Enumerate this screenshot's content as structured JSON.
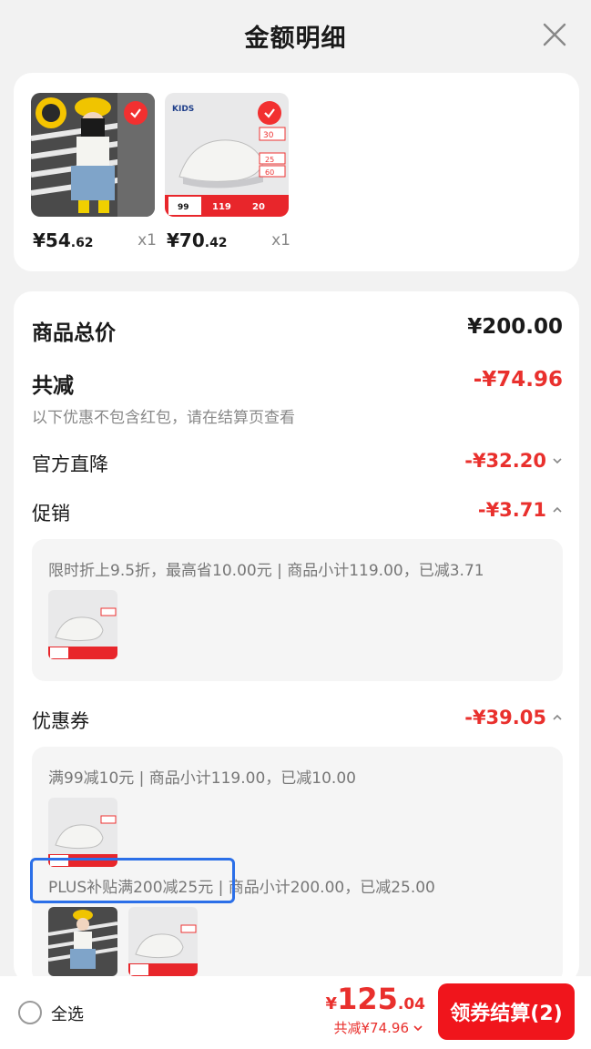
{
  "header": {
    "title": "金额明细"
  },
  "products": [
    {
      "price_int": "¥54",
      "price_dec": ".62",
      "qty": "x1"
    },
    {
      "price_int": "¥70",
      "price_dec": ".42",
      "qty": "x1"
    }
  ],
  "thumb_texts": {
    "kids": "KIDS",
    "p99": "99",
    "p119": "119",
    "p20": "20",
    "p30": "30",
    "p25": "25",
    "p60": "60"
  },
  "summary": {
    "total_label": "商品总价",
    "total_value": "¥200.00",
    "reduce_label": "共减",
    "reduce_value": "-¥74.96",
    "note": "以下优惠不包含红包，请在结算页查看"
  },
  "discounts": {
    "official": {
      "label": "官方直降",
      "value": "-¥32.20"
    },
    "promo": {
      "label": "促销",
      "value": "-¥3.71",
      "detail": "限时折上9.5折，最高省10.00元 | 商品小计119.00，已减3.71"
    },
    "coupon": {
      "label": "优惠券",
      "value": "-¥39.05",
      "detail1": "满99减10元 | 商品小计119.00，已减10.00",
      "detail2": "PLUS补贴满200减25元 | 商品小计200.00，已减25.00"
    }
  },
  "bottom": {
    "select_all": "全选",
    "total_cur": "¥",
    "total_int": "125",
    "total_dec": ".04",
    "saved": "共减¥74.96",
    "checkout": "领券结算(2)"
  },
  "colors": {
    "accent": "#e9302d",
    "button": "#f0151c",
    "highlight": "#2b6fe8"
  }
}
